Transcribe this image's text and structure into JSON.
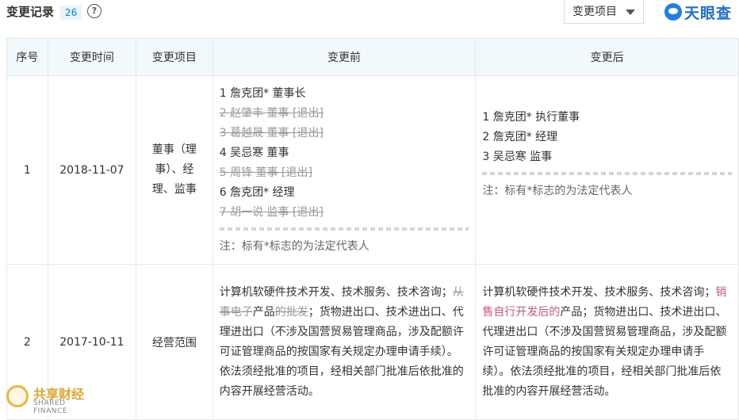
{
  "header": {
    "title": "变更记录",
    "count": "26",
    "help_icon": "question-circle-icon",
    "filter_label": "变更项目",
    "logo_text": "天眼查"
  },
  "table": {
    "columns": [
      "序号",
      "变更时间",
      "变更项目",
      "变更前",
      "变更后"
    ],
    "rows": [
      {
        "index": "1",
        "date": "2018-11-07",
        "item": "董事（理事）、经理、监事",
        "before": [
          {
            "text": "1 詹克团* 董事长",
            "struck": false
          },
          {
            "text": "2 赵肇丰 董事",
            "struck": true,
            "tag": "[退出]"
          },
          {
            "text": "3 葛越晟 董事",
            "struck": true,
            "tag": "[退出]"
          },
          {
            "text": "4 吴忌寒 董事",
            "struck": false
          },
          {
            "text": "5 周锋 董事",
            "struck": true,
            "tag": "[退出]"
          },
          {
            "text": "6 詹克团* 经理",
            "struck": false
          },
          {
            "text": "7 胡一说 监事",
            "struck": true,
            "tag": "[退出]"
          }
        ],
        "before_note": "注：标有*标志的为法定代表人",
        "after": [
          "1 詹克团* 执行董事",
          "2 詹克团* 经理",
          "3 吴忌寒 监事"
        ],
        "after_note": "注：标有*标志的为法定代表人"
      },
      {
        "index": "2",
        "date": "2017-10-11",
        "item": "经营范围",
        "before_parts": {
          "p1": "计算机软硬件技术开发、技术服务、技术咨询；",
          "p2_del": "从事电子",
          "p3": "产品",
          "p4_del": "的批发",
          "p5": "；货物进出口、技术进出口、代理进出口（不涉及国营贸易管理商品，涉及配额许可证管理商品的按国家有关规定办理申请手续）。依法须经批准的项目，经相关部门批准后依批准的内容开展经营活动。"
        },
        "after_parts": {
          "p1": "计算机软硬件技术开发、技术服务、技术咨询；",
          "p2_hl": "销售自行开发后的",
          "p3": "产品；货物进出口、技术进出口、代理进出口（不涉及国营贸易管理商品，涉及配额许可证管理商品的按国家有关规定办理申请手续）。依法须经批准的项目，经相关部门批准后依批准的内容开展经营活动。"
        }
      }
    ]
  },
  "watermark": {
    "cn": "共享财经",
    "en": "SHARED FINANCE"
  },
  "colors": {
    "accent": "#0084ff",
    "header_bg": "#f2f9fc",
    "highlight": "#e0517a",
    "struck": "#999999"
  }
}
